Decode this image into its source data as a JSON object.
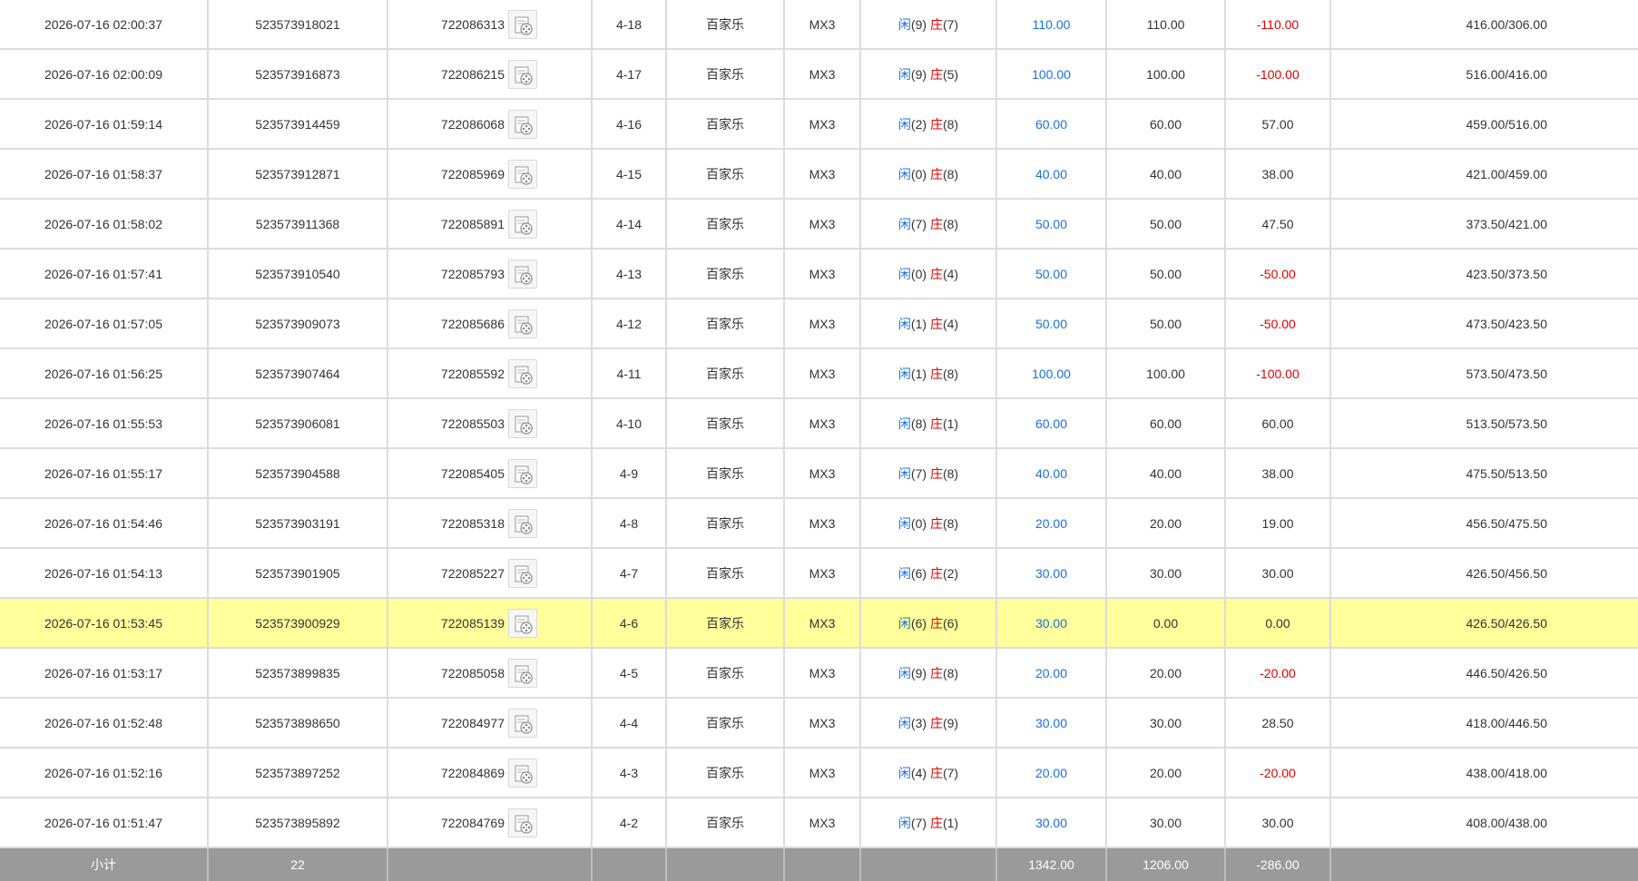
{
  "colors": {
    "blue": "#1a6fe0",
    "red": "#e00000",
    "highlight_row": "#ffff9b",
    "subtotal_bg": "#9a9a9a"
  },
  "rows": [
    {
      "time": "2026-07-16 02:00:37",
      "order_no": "523573918021",
      "round_id": "722086313",
      "shoe": "4-18",
      "game": "百家乐",
      "table": "MX3",
      "player_label": "闲",
      "player_score": "(9)",
      "banker_label": "庄",
      "banker_score": "(7)",
      "bet": "110.00",
      "valid_bet": "110.00",
      "win_loss": "-110.00",
      "win_loss_color": "red",
      "balance": "416.00/306.00",
      "highlight": false
    },
    {
      "time": "2026-07-16 02:00:09",
      "order_no": "523573916873",
      "round_id": "722086215",
      "shoe": "4-17",
      "game": "百家乐",
      "table": "MX3",
      "player_label": "闲",
      "player_score": "(9)",
      "banker_label": "庄",
      "banker_score": "(5)",
      "bet": "100.00",
      "valid_bet": "100.00",
      "win_loss": "-100.00",
      "win_loss_color": "red",
      "balance": "516.00/416.00",
      "highlight": false
    },
    {
      "time": "2026-07-16 01:59:14",
      "order_no": "523573914459",
      "round_id": "722086068",
      "shoe": "4-16",
      "game": "百家乐",
      "table": "MX3",
      "player_label": "闲",
      "player_score": "(2)",
      "banker_label": "庄",
      "banker_score": "(8)",
      "bet": "60.00",
      "valid_bet": "60.00",
      "win_loss": "57.00",
      "win_loss_color": "normal",
      "balance": "459.00/516.00",
      "highlight": false
    },
    {
      "time": "2026-07-16 01:58:37",
      "order_no": "523573912871",
      "round_id": "722085969",
      "shoe": "4-15",
      "game": "百家乐",
      "table": "MX3",
      "player_label": "闲",
      "player_score": "(0)",
      "banker_label": "庄",
      "banker_score": "(8)",
      "bet": "40.00",
      "valid_bet": "40.00",
      "win_loss": "38.00",
      "win_loss_color": "normal",
      "balance": "421.00/459.00",
      "highlight": false
    },
    {
      "time": "2026-07-16 01:58:02",
      "order_no": "523573911368",
      "round_id": "722085891",
      "shoe": "4-14",
      "game": "百家乐",
      "table": "MX3",
      "player_label": "闲",
      "player_score": "(7)",
      "banker_label": "庄",
      "banker_score": "(8)",
      "bet": "50.00",
      "valid_bet": "50.00",
      "win_loss": "47.50",
      "win_loss_color": "normal",
      "balance": "373.50/421.00",
      "highlight": false
    },
    {
      "time": "2026-07-16 01:57:41",
      "order_no": "523573910540",
      "round_id": "722085793",
      "shoe": "4-13",
      "game": "百家乐",
      "table": "MX3",
      "player_label": "闲",
      "player_score": "(0)",
      "banker_label": "庄",
      "banker_score": "(4)",
      "bet": "50.00",
      "valid_bet": "50.00",
      "win_loss": "-50.00",
      "win_loss_color": "red",
      "balance": "423.50/373.50",
      "highlight": false
    },
    {
      "time": "2026-07-16 01:57:05",
      "order_no": "523573909073",
      "round_id": "722085686",
      "shoe": "4-12",
      "game": "百家乐",
      "table": "MX3",
      "player_label": "闲",
      "player_score": "(1)",
      "banker_label": "庄",
      "banker_score": "(4)",
      "bet": "50.00",
      "valid_bet": "50.00",
      "win_loss": "-50.00",
      "win_loss_color": "red",
      "balance": "473.50/423.50",
      "highlight": false
    },
    {
      "time": "2026-07-16 01:56:25",
      "order_no": "523573907464",
      "round_id": "722085592",
      "shoe": "4-11",
      "game": "百家乐",
      "table": "MX3",
      "player_label": "闲",
      "player_score": "(1)",
      "banker_label": "庄",
      "banker_score": "(8)",
      "bet": "100.00",
      "valid_bet": "100.00",
      "win_loss": "-100.00",
      "win_loss_color": "red",
      "balance": "573.50/473.50",
      "highlight": false
    },
    {
      "time": "2026-07-16 01:55:53",
      "order_no": "523573906081",
      "round_id": "722085503",
      "shoe": "4-10",
      "game": "百家乐",
      "table": "MX3",
      "player_label": "闲",
      "player_score": "(8)",
      "banker_label": "庄",
      "banker_score": "(1)",
      "bet": "60.00",
      "valid_bet": "60.00",
      "win_loss": "60.00",
      "win_loss_color": "normal",
      "balance": "513.50/573.50",
      "highlight": false
    },
    {
      "time": "2026-07-16 01:55:17",
      "order_no": "523573904588",
      "round_id": "722085405",
      "shoe": "4-9",
      "game": "百家乐",
      "table": "MX3",
      "player_label": "闲",
      "player_score": "(7)",
      "banker_label": "庄",
      "banker_score": "(8)",
      "bet": "40.00",
      "valid_bet": "40.00",
      "win_loss": "38.00",
      "win_loss_color": "normal",
      "balance": "475.50/513.50",
      "highlight": false
    },
    {
      "time": "2026-07-16 01:54:46",
      "order_no": "523573903191",
      "round_id": "722085318",
      "shoe": "4-8",
      "game": "百家乐",
      "table": "MX3",
      "player_label": "闲",
      "player_score": "(0)",
      "banker_label": "庄",
      "banker_score": "(8)",
      "bet": "20.00",
      "valid_bet": "20.00",
      "win_loss": "19.00",
      "win_loss_color": "normal",
      "balance": "456.50/475.50",
      "highlight": false
    },
    {
      "time": "2026-07-16 01:54:13",
      "order_no": "523573901905",
      "round_id": "722085227",
      "shoe": "4-7",
      "game": "百家乐",
      "table": "MX3",
      "player_label": "闲",
      "player_score": "(6)",
      "banker_label": "庄",
      "banker_score": "(2)",
      "bet": "30.00",
      "valid_bet": "30.00",
      "win_loss": "30.00",
      "win_loss_color": "normal",
      "balance": "426.50/456.50",
      "highlight": false
    },
    {
      "time": "2026-07-16 01:53:45",
      "order_no": "523573900929",
      "round_id": "722085139",
      "shoe": "4-6",
      "game": "百家乐",
      "table": "MX3",
      "player_label": "闲",
      "player_score": "(6)",
      "banker_label": "庄",
      "banker_score": "(6)",
      "bet": "30.00",
      "valid_bet": "0.00",
      "win_loss": "0.00",
      "win_loss_color": "normal",
      "balance": "426.50/426.50",
      "highlight": true
    },
    {
      "time": "2026-07-16 01:53:17",
      "order_no": "523573899835",
      "round_id": "722085058",
      "shoe": "4-5",
      "game": "百家乐",
      "table": "MX3",
      "player_label": "闲",
      "player_score": "(9)",
      "banker_label": "庄",
      "banker_score": "(8)",
      "bet": "20.00",
      "valid_bet": "20.00",
      "win_loss": "-20.00",
      "win_loss_color": "red",
      "balance": "446.50/426.50",
      "highlight": false
    },
    {
      "time": "2026-07-16 01:52:48",
      "order_no": "523573898650",
      "round_id": "722084977",
      "shoe": "4-4",
      "game": "百家乐",
      "table": "MX3",
      "player_label": "闲",
      "player_score": "(3)",
      "banker_label": "庄",
      "banker_score": "(9)",
      "bet": "30.00",
      "valid_bet": "30.00",
      "win_loss": "28.50",
      "win_loss_color": "normal",
      "balance": "418.00/446.50",
      "highlight": false
    },
    {
      "time": "2026-07-16 01:52:16",
      "order_no": "523573897252",
      "round_id": "722084869",
      "shoe": "4-3",
      "game": "百家乐",
      "table": "MX3",
      "player_label": "闲",
      "player_score": "(4)",
      "banker_label": "庄",
      "banker_score": "(7)",
      "bet": "20.00",
      "valid_bet": "20.00",
      "win_loss": "-20.00",
      "win_loss_color": "red",
      "balance": "438.00/418.00",
      "highlight": false
    },
    {
      "time": "2026-07-16 01:51:47",
      "order_no": "523573895892",
      "round_id": "722084769",
      "shoe": "4-2",
      "game": "百家乐",
      "table": "MX3",
      "player_label": "闲",
      "player_score": "(7)",
      "banker_label": "庄",
      "banker_score": "(1)",
      "bet": "30.00",
      "valid_bet": "30.00",
      "win_loss": "30.00",
      "win_loss_color": "normal",
      "balance": "408.00/438.00",
      "highlight": false
    }
  ],
  "subtotal": {
    "label": "小计",
    "count": "22",
    "bet_total": "1342.00",
    "valid_total": "1206.00",
    "win_loss_total": "-286.00"
  }
}
